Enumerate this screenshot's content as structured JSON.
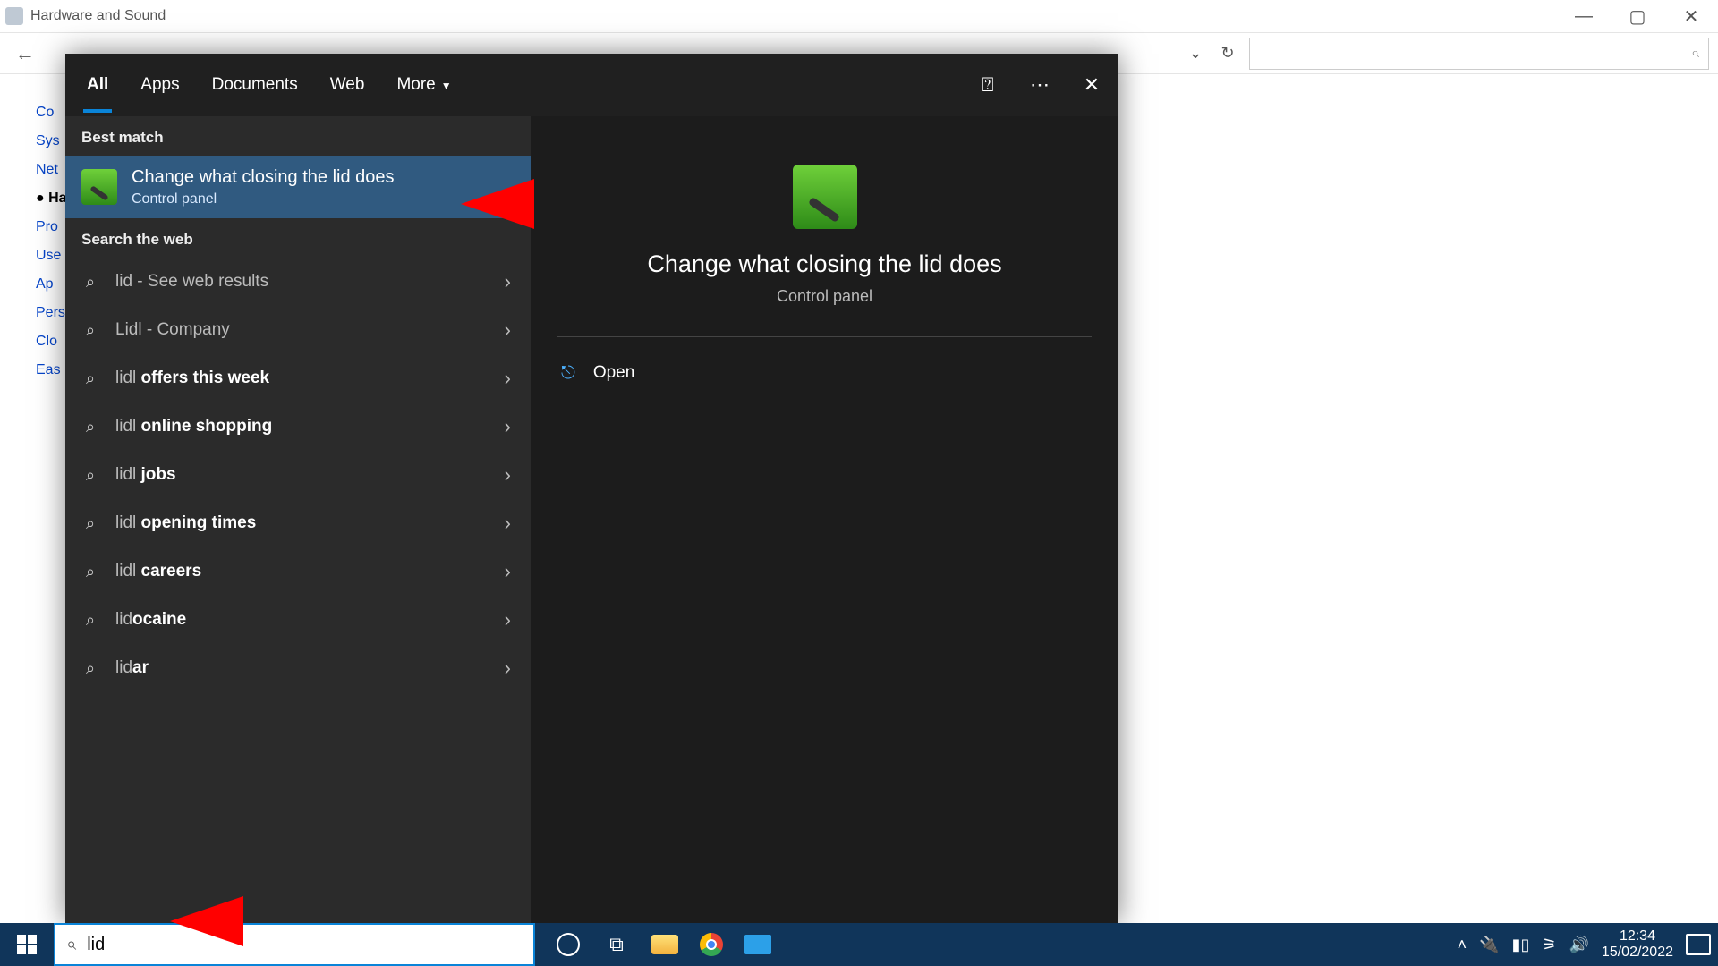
{
  "cp": {
    "title": "Hardware and Sound",
    "side_items": [
      "Co",
      "Sys",
      "Net",
      "Ha",
      "Pro",
      "Use",
      "Ap",
      "Pers",
      "Clo",
      "Eas"
    ],
    "side_current_index": 3
  },
  "search": {
    "tabs": {
      "all": "All",
      "apps": "Apps",
      "documents": "Documents",
      "web": "Web",
      "more": "More"
    },
    "sections": {
      "best": "Best match",
      "web": "Search the web"
    },
    "best": {
      "title": "Change what closing the lid does",
      "subtitle": "Control panel"
    },
    "web_items": [
      {
        "pre": "lid",
        "bold": "",
        "suffix": " - See web results"
      },
      {
        "pre": "Lidl",
        "bold": "",
        "suffix": " - Company"
      },
      {
        "pre": "lidl",
        "bold": " offers this week",
        "suffix": ""
      },
      {
        "pre": "lidl",
        "bold": " online shopping",
        "suffix": ""
      },
      {
        "pre": "lidl",
        "bold": " jobs",
        "suffix": ""
      },
      {
        "pre": "lidl",
        "bold": " opening times",
        "suffix": ""
      },
      {
        "pre": "lidl",
        "bold": " careers",
        "suffix": ""
      },
      {
        "pre": "lid",
        "bold": "ocaine",
        "suffix": ""
      },
      {
        "pre": "lid",
        "bold": "ar",
        "suffix": ""
      }
    ],
    "preview": {
      "title": "Change what closing the lid does",
      "subtitle": "Control panel",
      "open": "Open"
    },
    "query": "lid"
  },
  "taskbar": {
    "time": "12:34",
    "date": "15/02/2022"
  }
}
